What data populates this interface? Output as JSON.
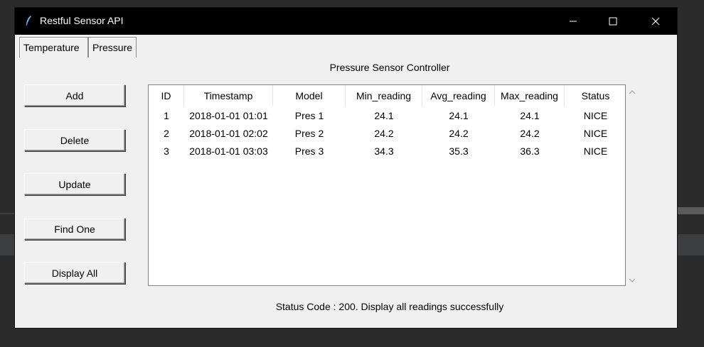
{
  "window": {
    "title": "Restful Sensor API"
  },
  "tabs": [
    {
      "label": "Temperature"
    },
    {
      "label": "Pressure"
    }
  ],
  "panel": {
    "title": "Pressure Sensor Controller"
  },
  "buttons": {
    "add": "Add",
    "delete": "Delete",
    "update": "Update",
    "find_one": "Find One",
    "display_all": "Display All"
  },
  "table": {
    "columns": [
      "ID",
      "Timestamp",
      "Model",
      "Min_reading",
      "Avg_reading",
      "Max_reading",
      "Status"
    ],
    "rows": [
      [
        "1",
        "2018-01-01 01:01",
        "Pres 1",
        "24.1",
        "24.1",
        "24.1",
        "NICE"
      ],
      [
        "2",
        "2018-01-01 02:02",
        "Pres 2",
        "24.2",
        "24.2",
        "24.2",
        "NICE"
      ],
      [
        "3",
        "2018-01-01 03:03",
        "Pres 3",
        "34.3",
        "35.3",
        "36.3",
        "NICE"
      ]
    ]
  },
  "status": {
    "text": "Status Code :  200.  Display all readings successfully"
  }
}
